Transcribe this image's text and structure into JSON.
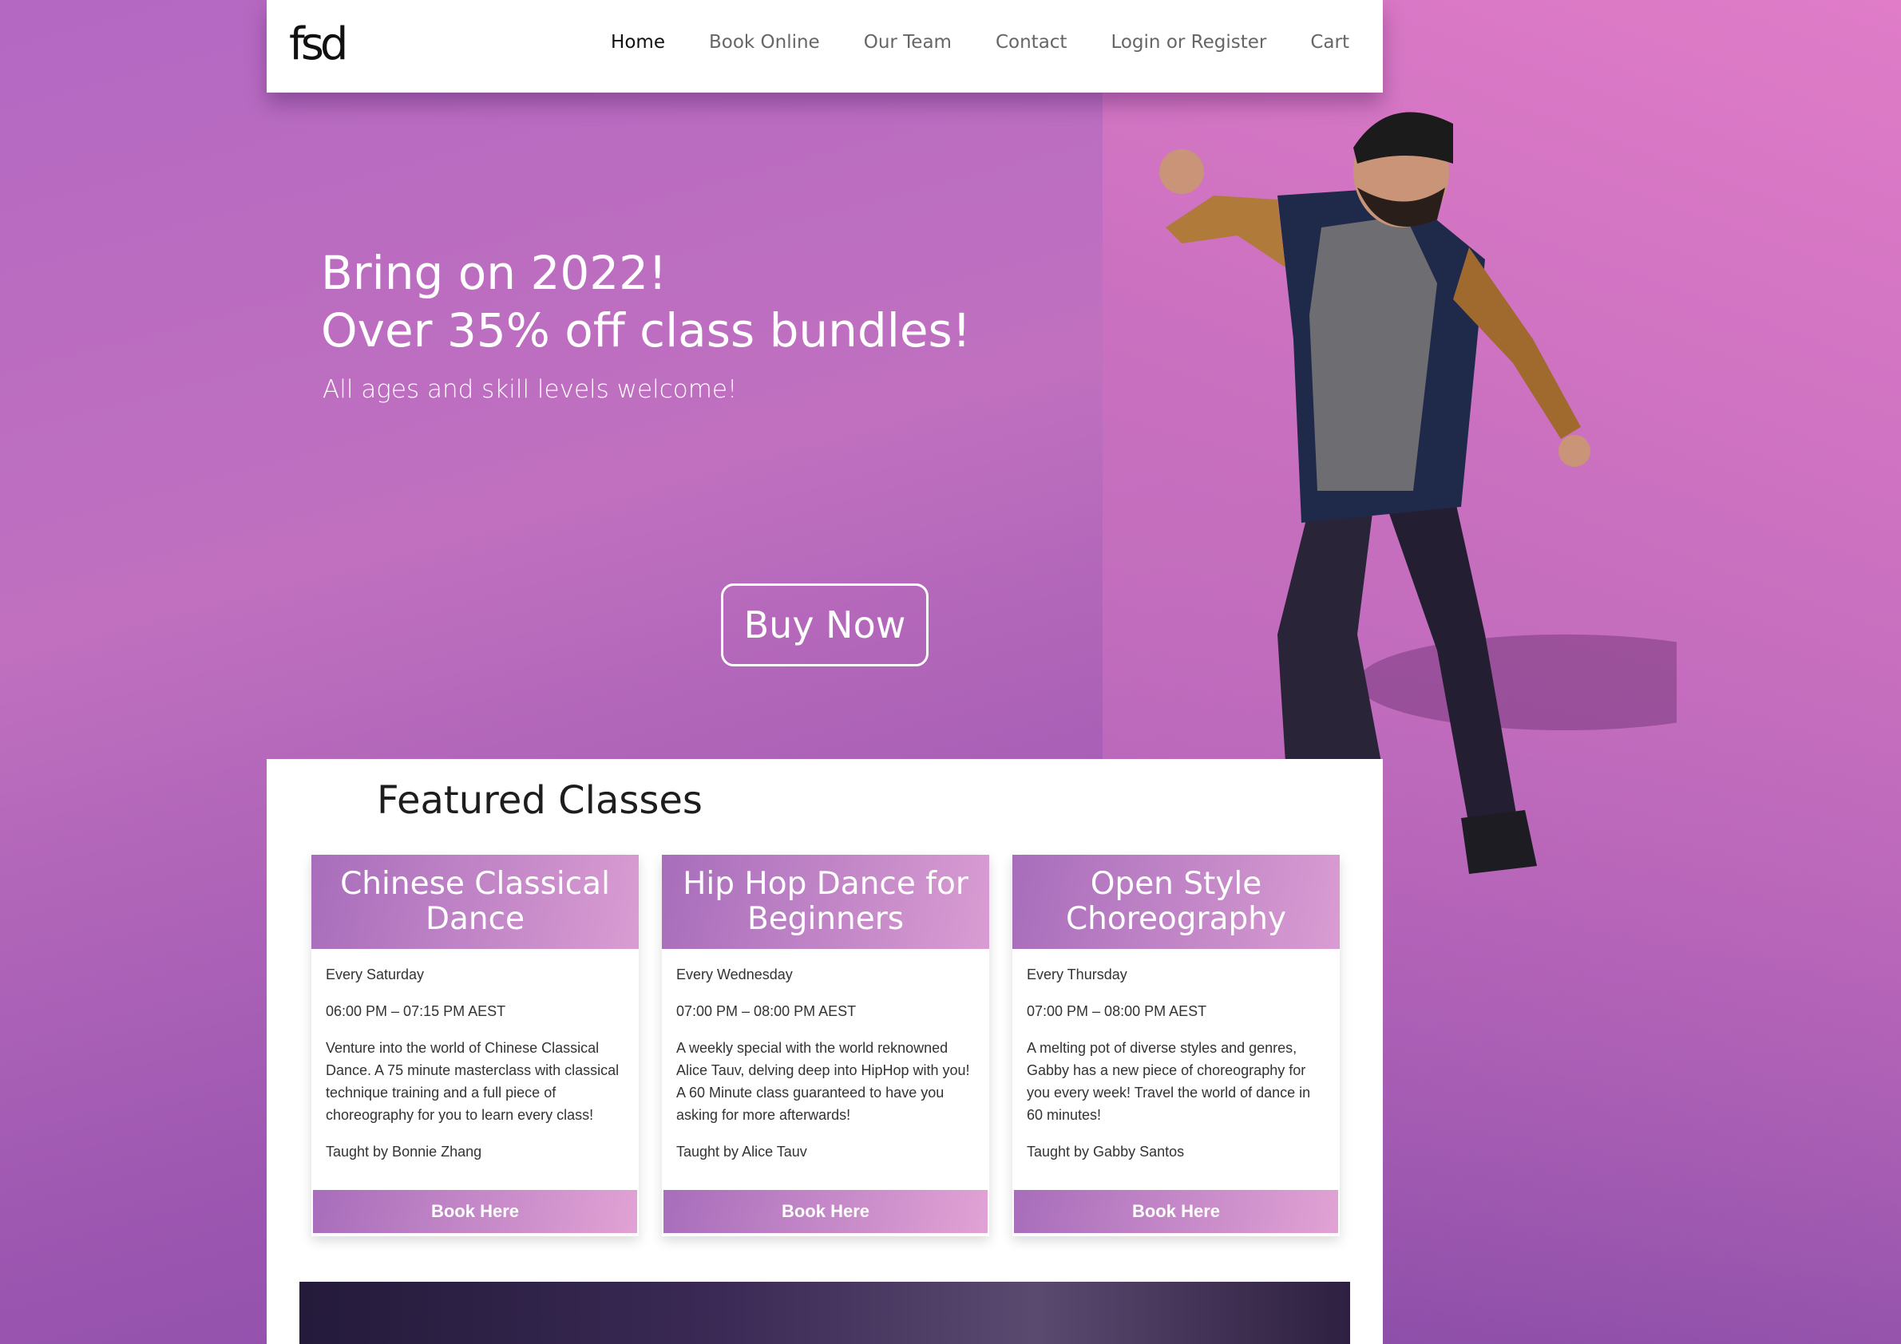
{
  "header": {
    "logo": "fsd",
    "nav": [
      {
        "label": "Home"
      },
      {
        "label": "Book Online"
      },
      {
        "label": "Our Team"
      },
      {
        "label": "Contact"
      },
      {
        "label": "Login or Register"
      },
      {
        "label": "Cart"
      }
    ]
  },
  "hero": {
    "title_line1": "Bring on 2022!",
    "title_line2": "Over 35% off class bundles!",
    "subtitle": "All ages and skill levels welcome!",
    "button": "Buy Now"
  },
  "featured": {
    "title": "Featured Classes",
    "classes": [
      {
        "name": "Chinese Classical Dance",
        "day": "Every Saturday",
        "time": "06:00 PM – 07:15 PM AEST",
        "description": "Venture into the world of Chinese Classical Dance. A 75 minute masterclass with classical technique training and a full piece of choreography for you to learn every class!",
        "teacher": "Taught by Bonnie Zhang",
        "button": "Book Here"
      },
      {
        "name": "Hip Hop Dance for Beginners",
        "day": "Every Wednesday",
        "time": "07:00 PM – 08:00 PM AEST",
        "description": "A weekly special with the world reknowned Alice Tauv, delving deep into HipHop with you! A 60 Minute class guaranteed to have you asking for more afterwards!",
        "teacher": "Taught by Alice Tauv",
        "button": "Book Here"
      },
      {
        "name": "Open Style Choreography",
        "day": "Every Thursday",
        "time": "07:00 PM – 08:00 PM AEST",
        "description": "A melting pot of diverse styles and genres, Gabby has a new piece of choreography for you every week! Travel the world of dance in 60 minutes!",
        "teacher": "Taught by Gabby Santos",
        "button": "Book Here"
      }
    ]
  },
  "colors": {
    "accent": "#b46ec4",
    "card_header": "#c285c9"
  }
}
